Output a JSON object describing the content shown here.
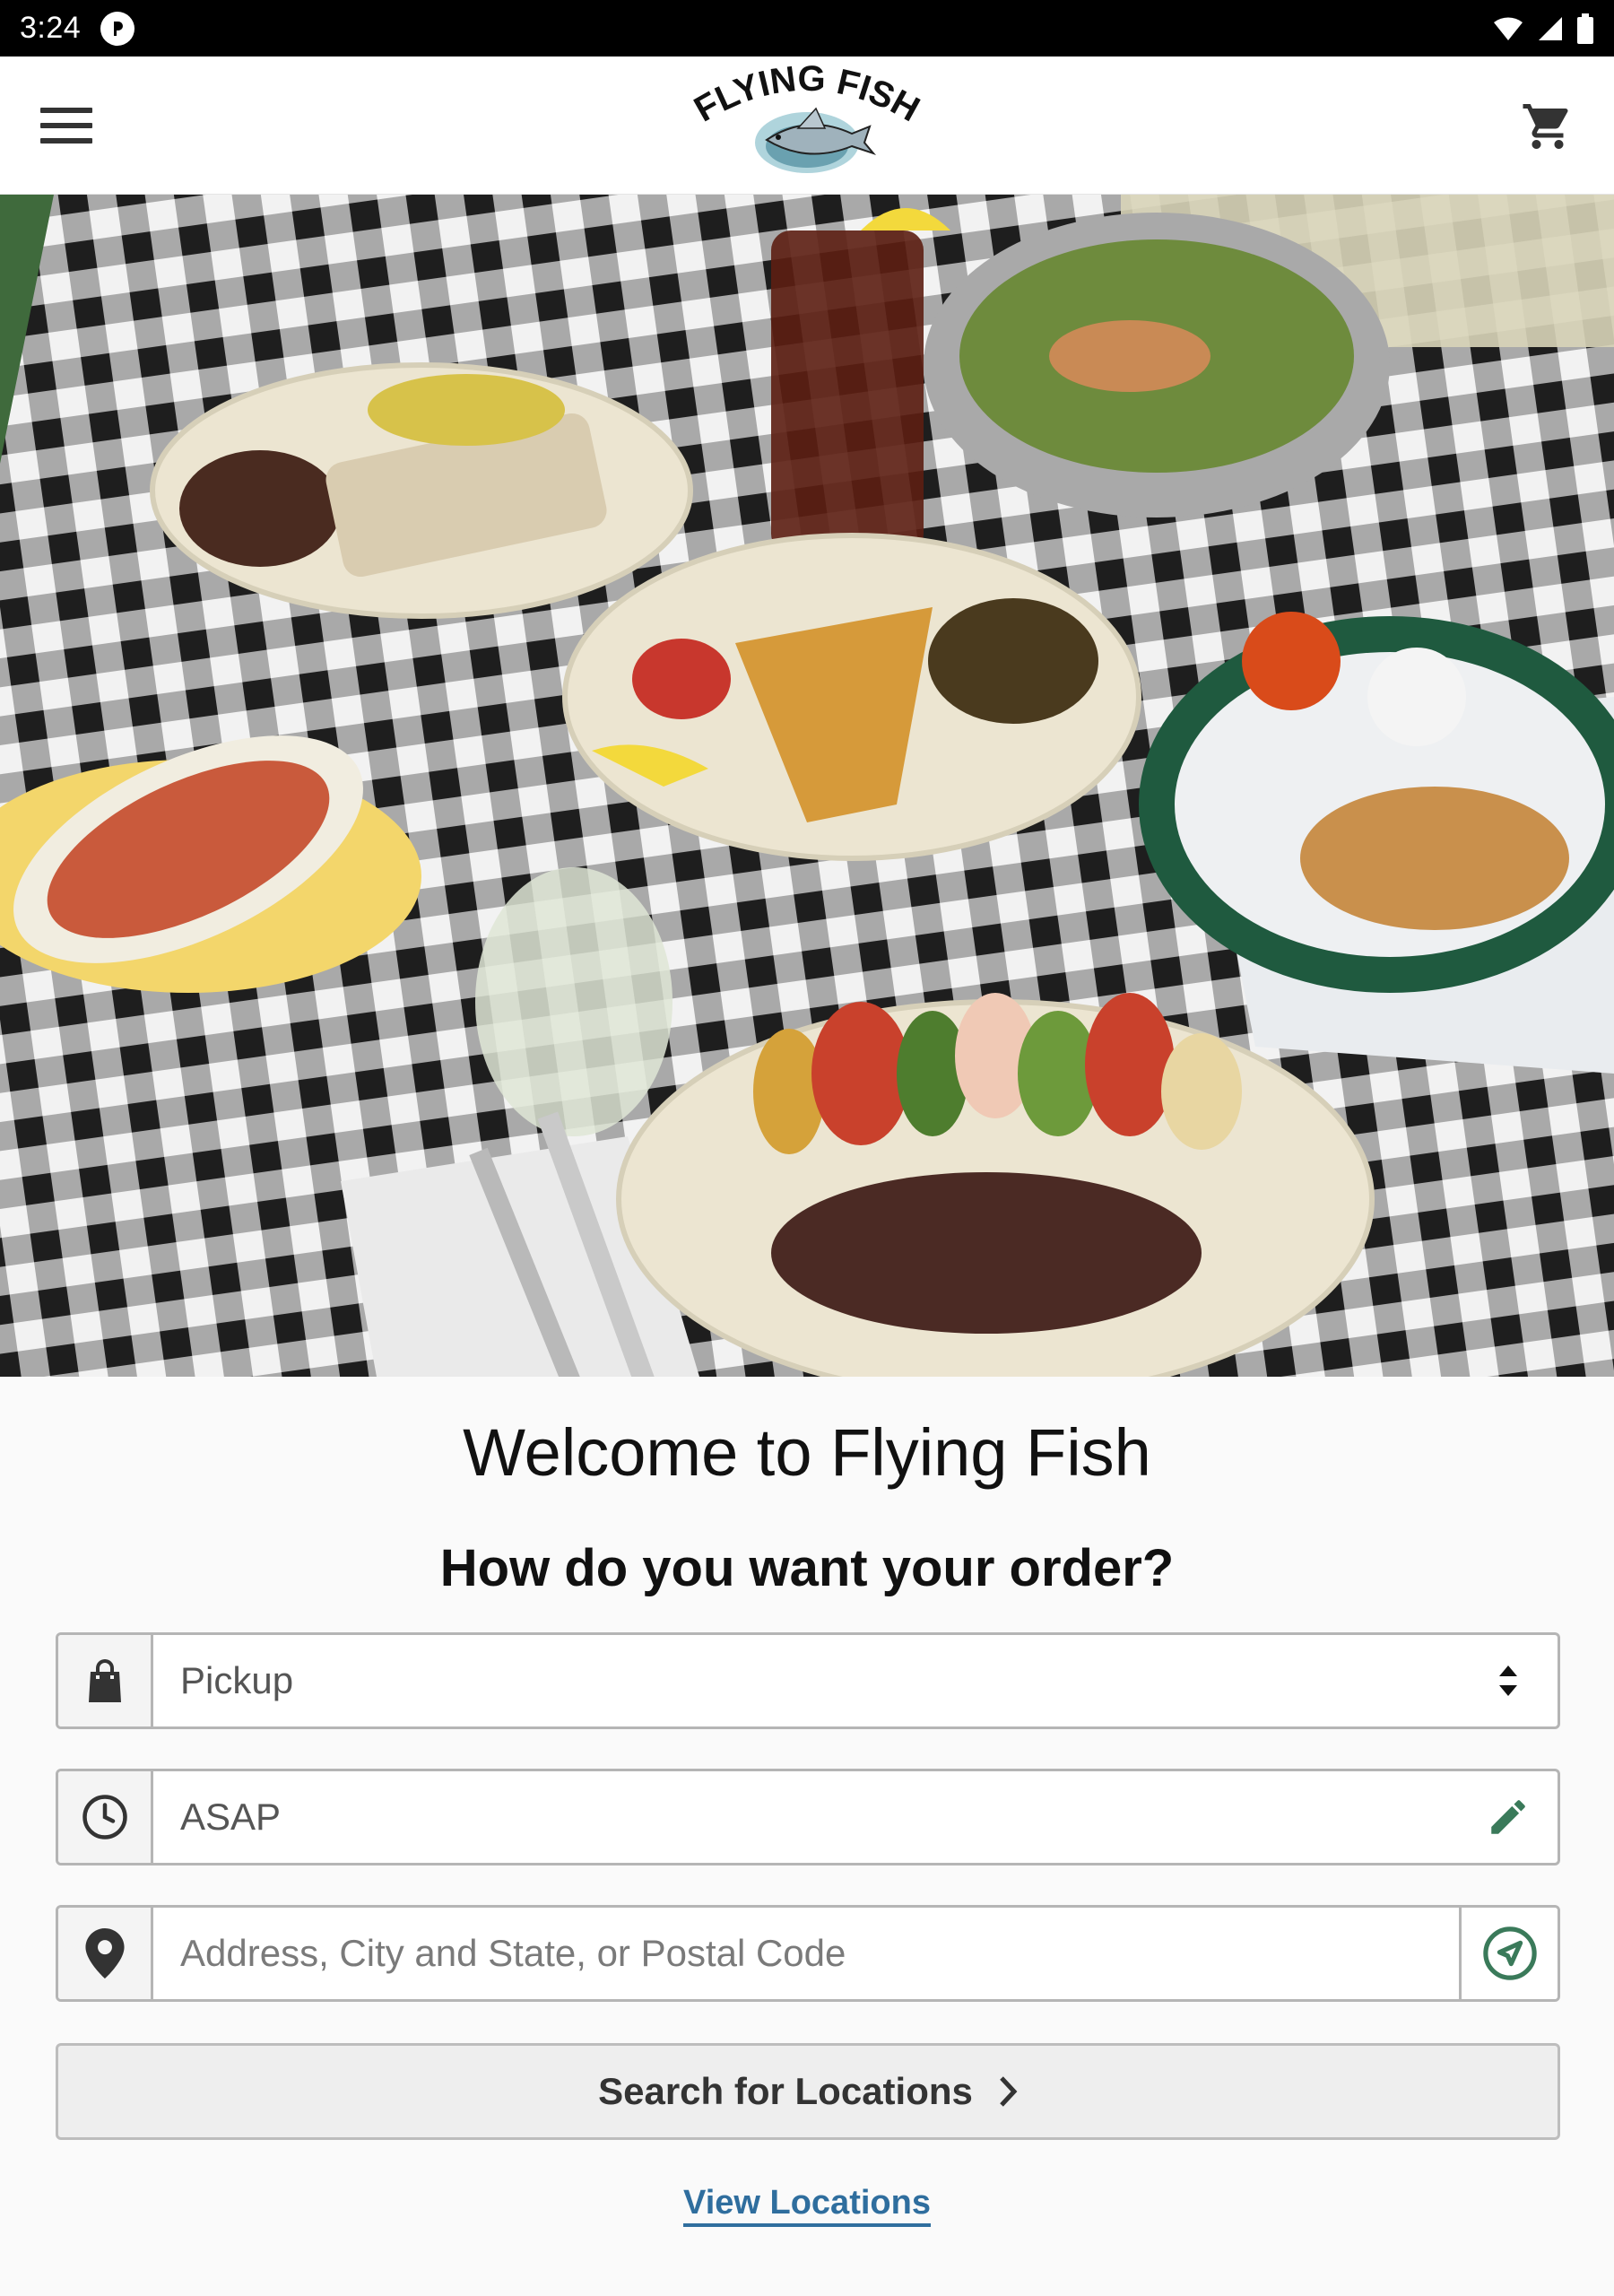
{
  "status_bar": {
    "time": "3:24",
    "icons": [
      "p-notification-icon",
      "wifi-icon",
      "cell-signal-icon",
      "battery-icon"
    ]
  },
  "header": {
    "logo_text": "FLYING FISH",
    "menu_icon": "hamburger-menu-icon",
    "cart_icon": "shopping-cart-icon"
  },
  "hero": {
    "description_icon": "food-photo"
  },
  "main": {
    "welcome_title": "Welcome to Flying Fish",
    "order_question": "How do you want your order?",
    "order_type": {
      "icon": "shopping-bag-icon",
      "selected": "Pickup",
      "trail_icon": "select-arrows-icon"
    },
    "order_time": {
      "icon": "clock-icon",
      "value": "ASAP",
      "trail_icon": "pencil-edit-icon"
    },
    "address": {
      "icon": "map-pin-icon",
      "placeholder": "Address, City and State, or Postal Code",
      "trail_icon": "navigation-arrow-icon"
    },
    "search_button_label": "Search for Locations",
    "view_locations_label": "View Locations"
  },
  "colors": {
    "accent_green": "#3a7a5a",
    "link_blue": "#2f6e9e",
    "border": "#b5b5b5"
  }
}
